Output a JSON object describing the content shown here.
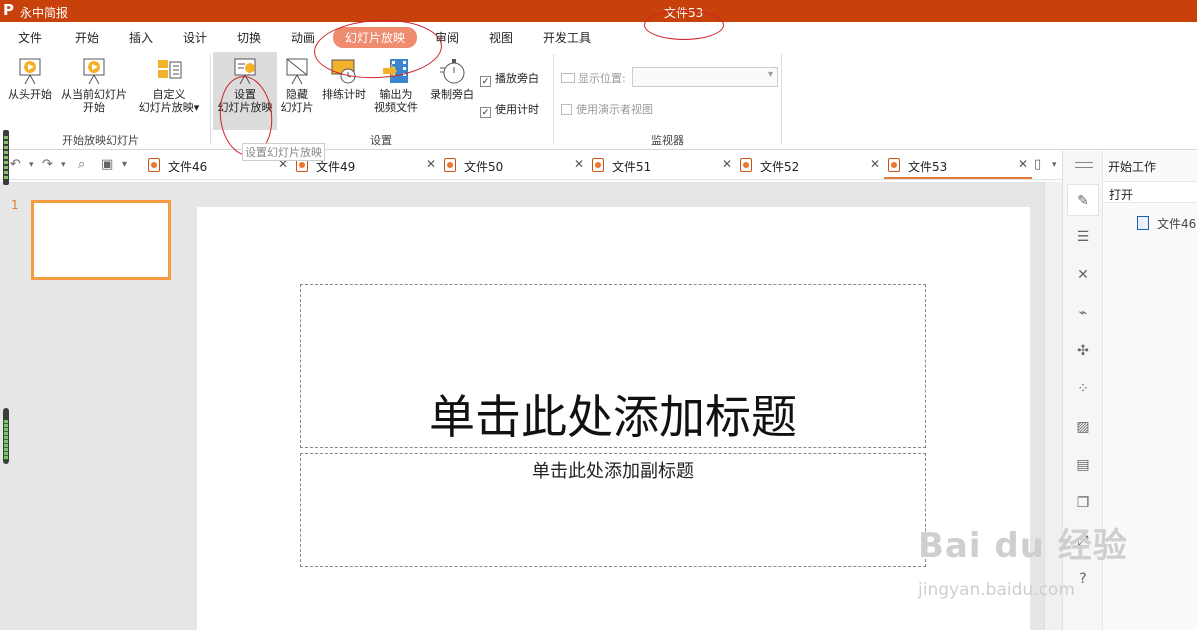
{
  "titlebar": {
    "app_name": "永中简报",
    "document_title": "文件53"
  },
  "menu": {
    "tabs": [
      "文件",
      "开始",
      "插入",
      "设计",
      "切换",
      "动画",
      "幻灯片放映",
      "审阅",
      "视图",
      "开发工具"
    ],
    "active": "幻灯片放映"
  },
  "ribbon": {
    "from_start": "从头开始",
    "from_current_1": "从当前幻灯片",
    "from_current_2": "开始",
    "custom_1": "自定义",
    "custom_2": "幻灯片放映",
    "start_group_label": "开始放映幻灯片",
    "setup_1": "设置",
    "setup_2": "幻灯片放映",
    "hide_1": "隐藏",
    "hide_2": "幻灯片",
    "rehearse": "排练计时",
    "export_1": "输出为",
    "export_2": "视频文件",
    "record": "录制旁白",
    "play_narration": "播放旁白",
    "use_timing": "使用计时",
    "setup_group_label": "设置",
    "display_position": "显示位置:",
    "presenter_view": "使用演示者视图",
    "monitor_group_label": "监视器",
    "tooltip": "设置幻灯片放映"
  },
  "doc_tabs": [
    "文件46",
    "文件49",
    "文件50",
    "文件51",
    "文件52",
    "文件53"
  ],
  "active_doc": "文件53",
  "thumbs": {
    "slide_number": "1"
  },
  "slide": {
    "title_placeholder": "单击此处添加标题",
    "subtitle_placeholder": "单击此处添加副标题"
  },
  "right_panel": {
    "title": "开始工作",
    "section": "打开",
    "recent_file": "文件46"
  },
  "watermark": {
    "line1": "Bai du 经验",
    "line2": "jingyan.baidu.com"
  },
  "colors": {
    "brand": "#c8410b",
    "active_tab": "#ef8b6e",
    "thumb_border": "#f29b3f"
  }
}
